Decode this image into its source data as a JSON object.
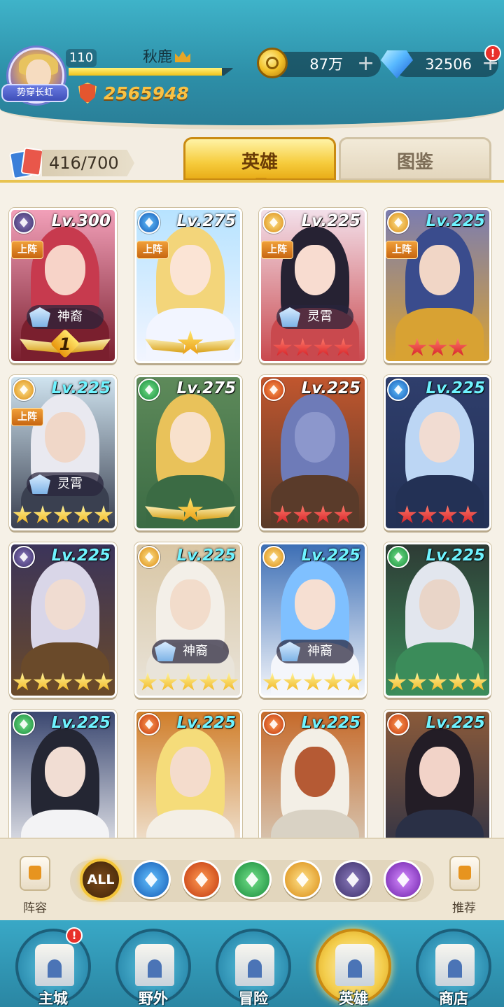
{
  "colors": {
    "accent_gold": "#f3c53a",
    "header_teal": "#3fb3c9",
    "power_gold": "#f9c244",
    "level_cyan": "#6ff3ff"
  },
  "player": {
    "avatar_title": "势穿长虹",
    "level": "110",
    "name": "秋鹿",
    "xp_fraction": 0.93,
    "power": "2565948"
  },
  "resources": {
    "gold": "87万",
    "gems": "32506",
    "alert": "!"
  },
  "collection": {
    "count": "416/700"
  },
  "tabs": {
    "heroes": "英雄",
    "codex": "图鉴"
  },
  "heroes": [
    {
      "element": "shadow",
      "level": "Lv.300",
      "lineup": "上阵",
      "faction": "神裔",
      "stars": 0,
      "star_color": "",
      "wing": "1"
    },
    {
      "element": "water",
      "level": "Lv.275",
      "lineup": "上阵",
      "faction": "",
      "stars": 0,
      "star_color": "",
      "wing": "star"
    },
    {
      "element": "light",
      "level": "Lv.225",
      "lineup": "上阵",
      "faction": "灵霄",
      "stars": 4,
      "star_color": "red",
      "wing": ""
    },
    {
      "element": "light",
      "level": "Lv.225",
      "lineup": "上阵",
      "faction": "",
      "stars": 3,
      "star_color": "red",
      "wing": ""
    },
    {
      "element": "light",
      "level": "Lv.225",
      "lineup": "上阵",
      "faction": "灵霄",
      "stars": 5,
      "star_color": "gold",
      "wing": ""
    },
    {
      "element": "wind",
      "level": "Lv.275",
      "lineup": "",
      "faction": "",
      "stars": 0,
      "star_color": "",
      "wing": "star"
    },
    {
      "element": "fire",
      "level": "Lv.225",
      "lineup": "",
      "faction": "",
      "stars": 4,
      "star_color": "red",
      "wing": ""
    },
    {
      "element": "water",
      "level": "Lv.225",
      "lineup": "",
      "faction": "",
      "stars": 4,
      "star_color": "red",
      "wing": ""
    },
    {
      "element": "shadow",
      "level": "Lv.225",
      "lineup": "",
      "faction": "",
      "stars": 5,
      "star_color": "gold",
      "wing": ""
    },
    {
      "element": "light",
      "level": "Lv.225",
      "lineup": "",
      "faction": "神裔",
      "stars": 5,
      "star_color": "gold",
      "wing": ""
    },
    {
      "element": "light",
      "level": "Lv.225",
      "lineup": "",
      "faction": "神裔",
      "stars": 5,
      "star_color": "gold",
      "wing": ""
    },
    {
      "element": "wind",
      "level": "Lv.225",
      "lineup": "",
      "faction": "",
      "stars": 5,
      "star_color": "gold",
      "wing": ""
    },
    {
      "element": "wind",
      "level": "Lv.225",
      "lineup": "",
      "faction": "",
      "stars": 0,
      "star_color": "",
      "wing": ""
    },
    {
      "element": "fire",
      "level": "Lv.225",
      "lineup": "",
      "faction": "",
      "stars": 0,
      "star_color": "",
      "wing": ""
    },
    {
      "element": "fire",
      "level": "Lv.225",
      "lineup": "",
      "faction": "",
      "stars": 0,
      "star_color": "",
      "wing": ""
    },
    {
      "element": "fire",
      "level": "Lv.225",
      "lineup": "",
      "faction": "",
      "stars": 0,
      "star_color": "",
      "wing": ""
    }
  ],
  "filters": {
    "lineup_label": "阵容",
    "all_label": "ALL",
    "recommend_label": "推荐",
    "elements": [
      "water",
      "fire",
      "wind",
      "light",
      "shadow",
      "dark"
    ]
  },
  "nav": {
    "items": [
      {
        "label": "主城",
        "icon": "castle-icon",
        "alert": "!"
      },
      {
        "label": "野外",
        "icon": "portal-icon",
        "alert": ""
      },
      {
        "label": "冒险",
        "icon": "sword-icon",
        "alert": ""
      },
      {
        "label": "英雄",
        "icon": "helmet-icon",
        "alert": ""
      },
      {
        "label": "商店",
        "icon": "shop-icon",
        "alert": ""
      }
    ],
    "active": 3
  }
}
